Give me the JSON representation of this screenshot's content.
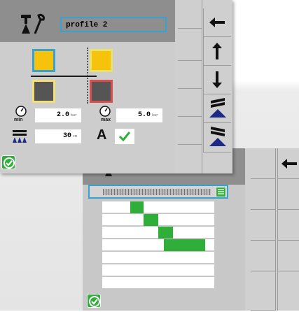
{
  "profile": {
    "name": "profile 2"
  },
  "pressure": {
    "min_label": "min",
    "min_value": "2.0",
    "min_unit": "bar",
    "max_label": "max",
    "max_value": "5.0",
    "max_unit": "bar"
  },
  "spacing": {
    "value": "30",
    "unit": "cm"
  },
  "auto_mode": {
    "label": "A"
  },
  "colors": {
    "yellow": "#f7c20c",
    "dark": "#555555",
    "accent_blue": "#38a2cf",
    "green": "#2fae39",
    "red": "#d94f4f",
    "navy": "#1c2a86"
  },
  "nav_buttons": [
    "arrow-left",
    "arrow-up",
    "arrow-down",
    "raise-boom",
    "lower-boom"
  ],
  "back_screen": {
    "bars": [
      {
        "start": 0.25,
        "end": 0.37
      },
      {
        "start": 0.37,
        "end": 0.5
      },
      {
        "start": 0.5,
        "end": 0.63
      },
      {
        "start": 0.55,
        "end": 0.92
      }
    ]
  }
}
